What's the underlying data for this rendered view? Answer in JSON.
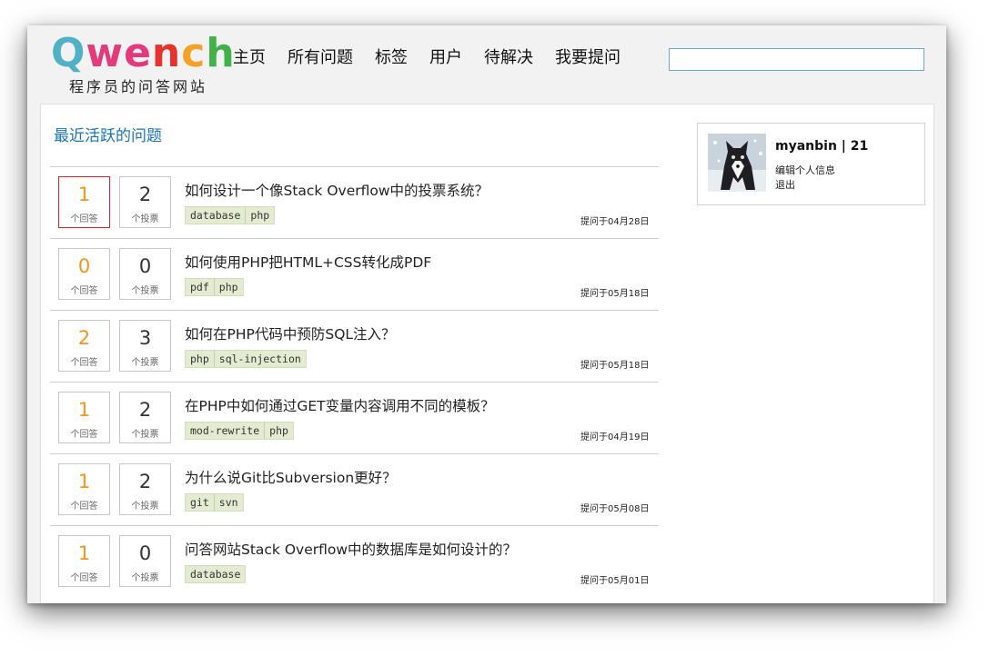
{
  "logo": {
    "letters": [
      {
        "char": "Q",
        "color": "#4fb0c6"
      },
      {
        "char": "w",
        "color": "#e23a7a"
      },
      {
        "char": "e",
        "color": "#e23a7a"
      },
      {
        "char": "n",
        "color": "#e3332c"
      },
      {
        "char": "c",
        "color": "#f3a128"
      },
      {
        "char": "h",
        "color": "#43b04a"
      }
    ],
    "tagline": "程序员的问答网站"
  },
  "nav": [
    "主页",
    "所有问题",
    "标签",
    "用户",
    "待解决",
    "我要提问"
  ],
  "search": {
    "value": "",
    "placeholder": ""
  },
  "section_title": "最近活跃的问题",
  "labels": {
    "answers": "个回答",
    "votes": "个投票"
  },
  "questions": [
    {
      "answers": "1",
      "votes": "2",
      "title": "如何设计一个像Stack Overflow中的投票系统？",
      "tags": [
        "database",
        "php"
      ],
      "date": "提问于04月28日",
      "highlight": true
    },
    {
      "answers": "0",
      "votes": "0",
      "title": "如何使用PHP把HTML+CSS转化成PDF",
      "tags": [
        "pdf",
        "php"
      ],
      "date": "提问于05月18日",
      "highlight": false
    },
    {
      "answers": "2",
      "votes": "3",
      "title": "如何在PHP代码中预防SQL注入？",
      "tags": [
        "php",
        "sql-injection"
      ],
      "date": "提问于05月18日",
      "highlight": false
    },
    {
      "answers": "1",
      "votes": "2",
      "title": "在PHP中如何通过GET变量内容调用不同的模板？",
      "tags": [
        "mod-rewrite",
        "php"
      ],
      "date": "提问于04月19日",
      "highlight": false
    },
    {
      "answers": "1",
      "votes": "2",
      "title": "为什么说Git比Subversion更好？",
      "tags": [
        "git",
        "svn"
      ],
      "date": "提问于05月08日",
      "highlight": false
    },
    {
      "answers": "1",
      "votes": "0",
      "title": "问答网站Stack Overflow中的数据库是如何设计的？",
      "tags": [
        "database"
      ],
      "date": "提问于05月01日",
      "highlight": false
    }
  ],
  "user": {
    "name": "myanbin | 21",
    "edit_profile": "编辑个人信息",
    "logout": "退出"
  },
  "colors": {
    "accent": "#1a73b8",
    "answer_count": "#f7941d",
    "highlight_border": "#d9232e",
    "tag_bg": "#e3ebd1",
    "search_border": "#6aa9c8"
  }
}
